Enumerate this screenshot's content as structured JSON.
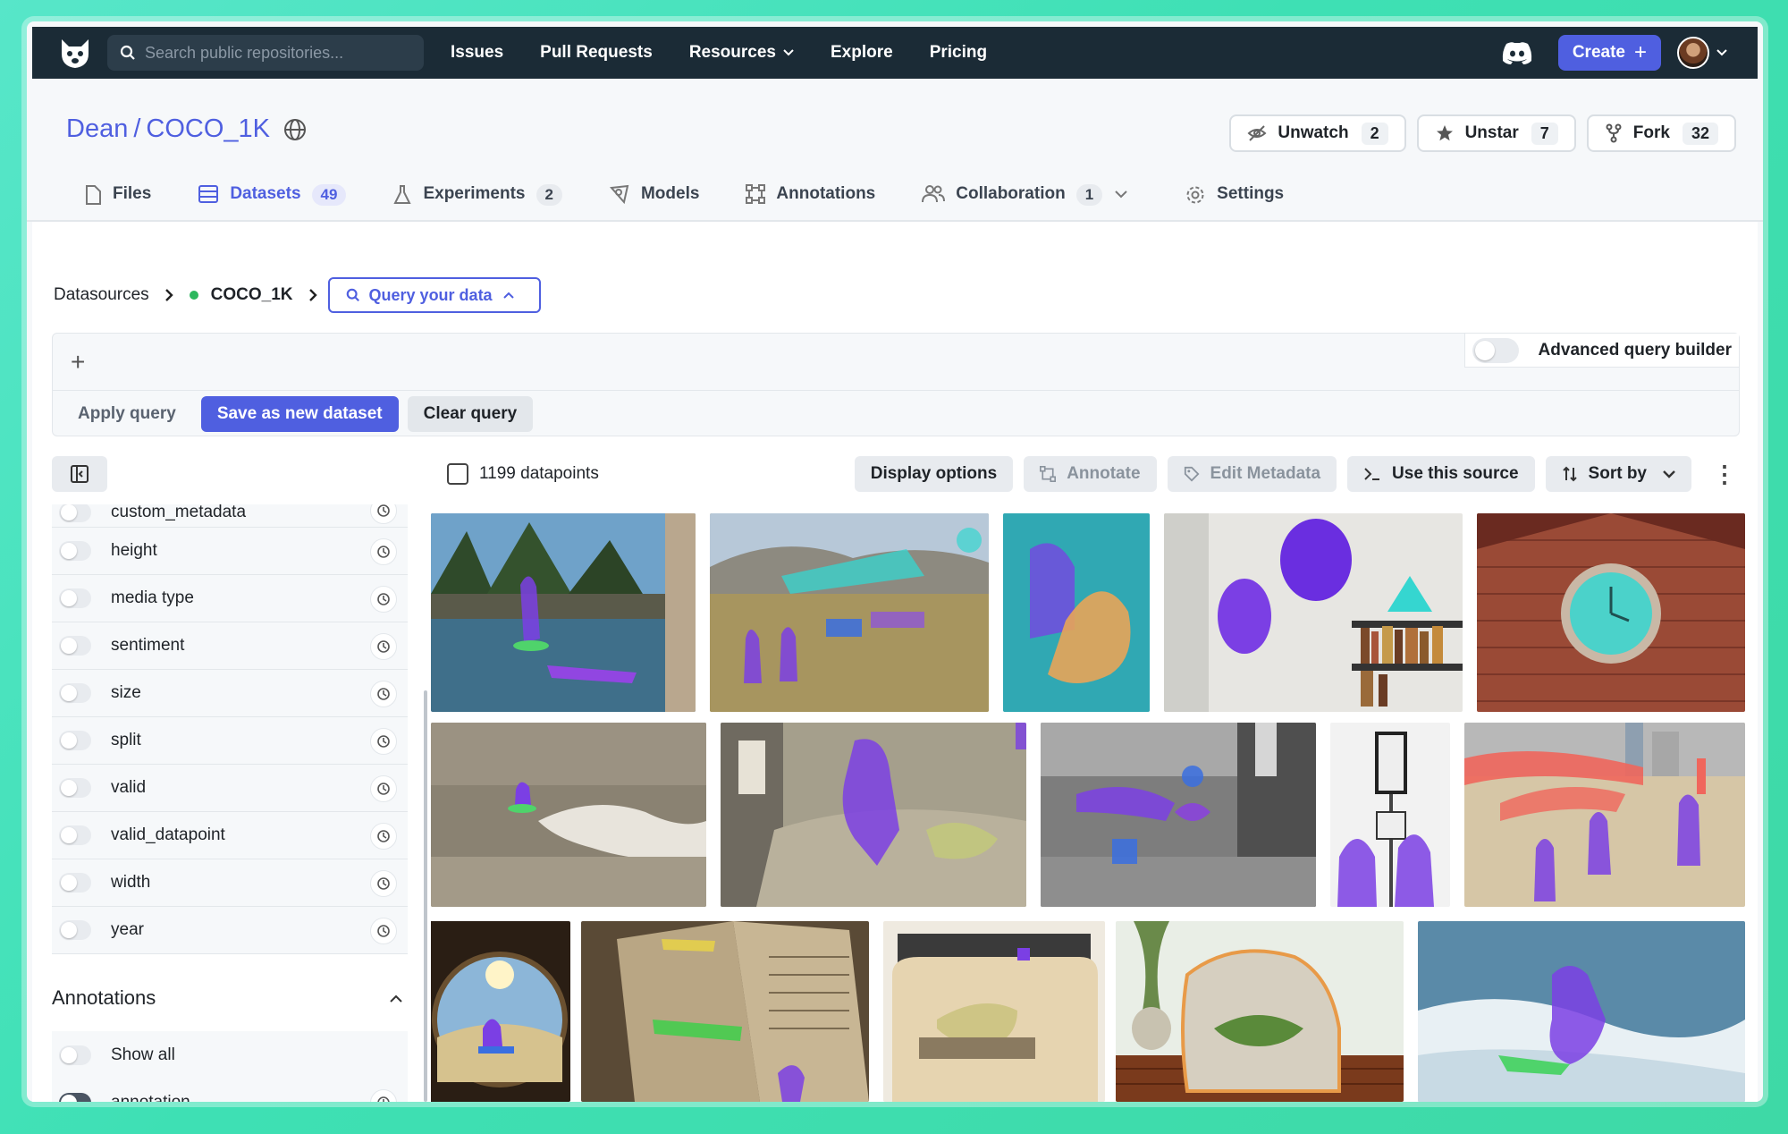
{
  "nav": {
    "search_placeholder": "Search public repositories...",
    "links": [
      "Issues",
      "Pull Requests",
      "Resources",
      "Explore",
      "Pricing"
    ],
    "create_label": "Create"
  },
  "repo": {
    "owner": "Dean",
    "separator": "/",
    "name": "COCO_1K",
    "unwatch_label": "Unwatch",
    "unwatch_count": "2",
    "unstar_label": "Unstar",
    "unstar_count": "7",
    "fork_label": "Fork",
    "fork_count": "32"
  },
  "tabs": [
    {
      "label": "Files",
      "badge": ""
    },
    {
      "label": "Datasets",
      "badge": "49"
    },
    {
      "label": "Experiments",
      "badge": "2"
    },
    {
      "label": "Models",
      "badge": ""
    },
    {
      "label": "Annotations",
      "badge": ""
    },
    {
      "label": "Collaboration",
      "badge": "1"
    },
    {
      "label": "Settings",
      "badge": ""
    }
  ],
  "breadcrumb": {
    "root": "Datasources",
    "current": "COCO_1K",
    "query_label": "Query your data"
  },
  "query": {
    "add_symbol": "+",
    "advanced_label": "Advanced query builder",
    "apply_label": "Apply query",
    "save_label": "Save as new dataset",
    "clear_label": "Clear query"
  },
  "toolbar": {
    "datapoints_label": "1199 datapoints",
    "display_options": "Display options",
    "annotate": "Annotate",
    "edit_metadata": "Edit Metadata",
    "use_source": "Use this source",
    "sort_by": "Sort by"
  },
  "sidebar": {
    "fields": [
      "custom_metadata",
      "height",
      "media type",
      "sentiment",
      "size",
      "split",
      "valid",
      "valid_datapoint",
      "width",
      "year"
    ],
    "annotations_header": "Annotations",
    "show_all_label": "Show all",
    "annotation_label": "annotation"
  },
  "colors": {
    "accent": "#4f5fe0",
    "nav_bg": "#1b2b36",
    "segment_purple": "#7b3fe4",
    "segment_cyan": "#35d6d0"
  }
}
